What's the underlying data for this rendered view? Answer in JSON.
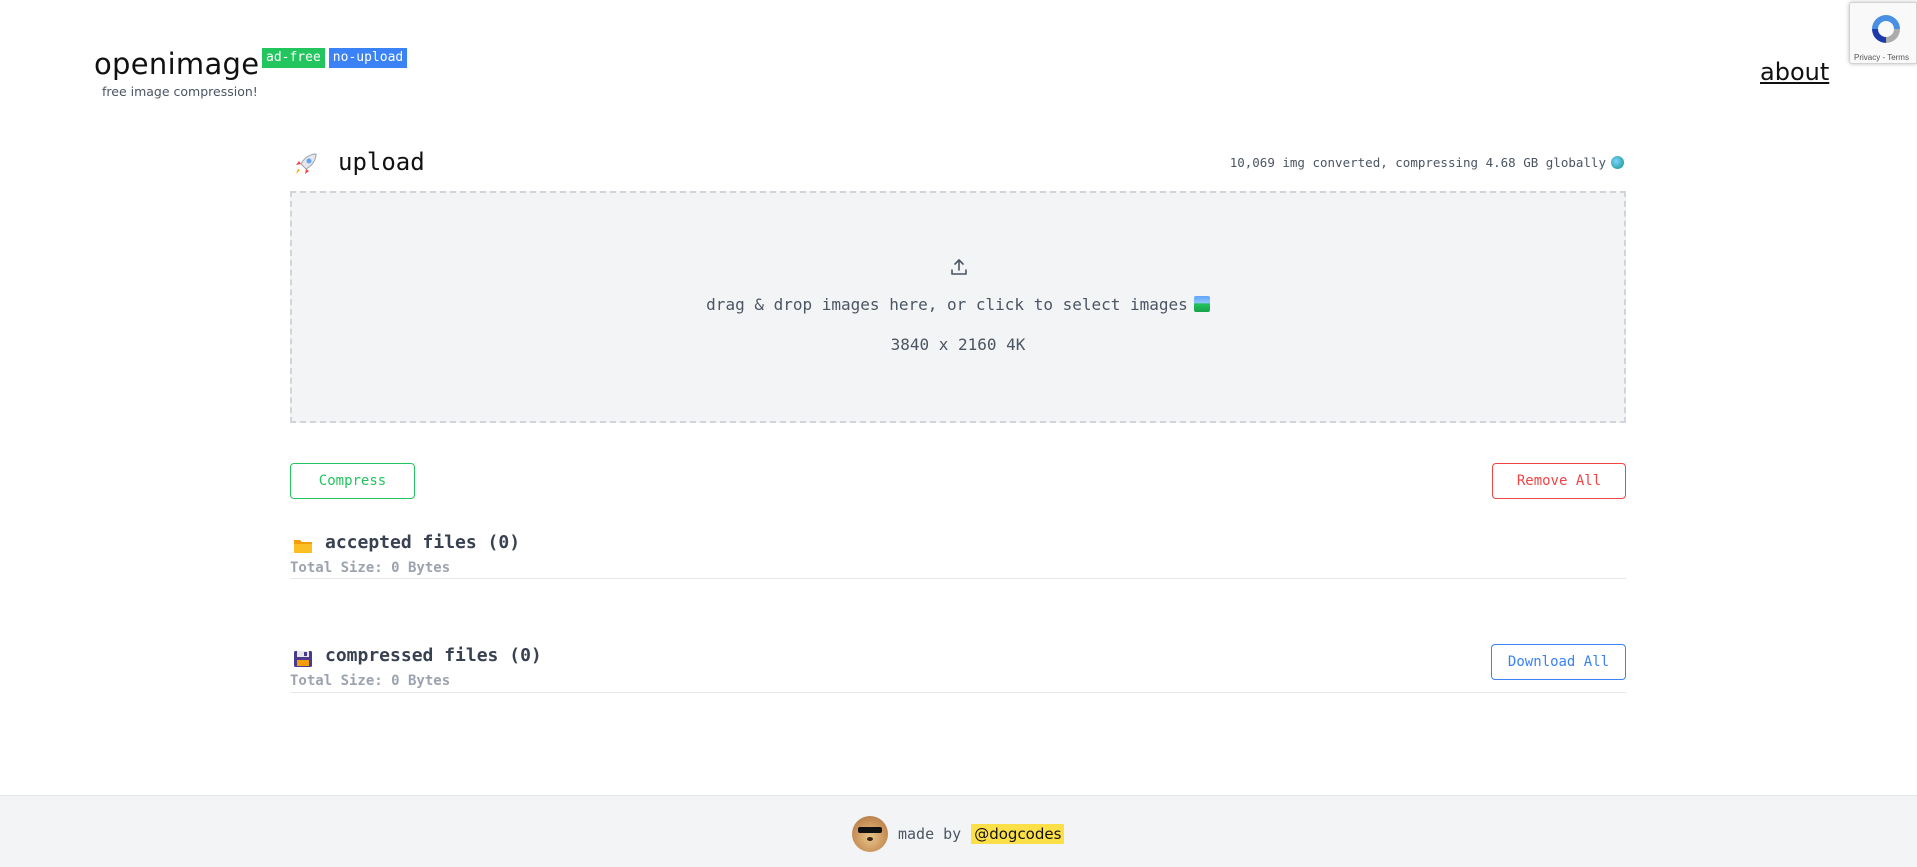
{
  "header": {
    "brand": "openimage",
    "badges": [
      "ad-free",
      "no-upload"
    ],
    "tagline": "free image compression!",
    "about_link": "about"
  },
  "recaptcha": {
    "footer_text": "Privacy - Terms"
  },
  "upload": {
    "title": "upload",
    "title_icon": "rocket-icon",
    "stats": "10,069 img converted, compressing 4.68 GB globally",
    "stats_icon": "globe-icon",
    "dropzone_icon": "upload-icon",
    "dropzone_text": "drag & drop images here, or click to select images",
    "dropzone_text_icon": "picture-icon",
    "resolution": "3840 x 2160 4K"
  },
  "actions": {
    "compress_label": "Compress",
    "remove_all_label": "Remove All",
    "download_all_label": "Download All"
  },
  "accepted": {
    "icon": "folder-icon",
    "title": "accepted files (0)",
    "total_size": "Total Size: 0 Bytes"
  },
  "compressed": {
    "icon": "floppy-disk-icon",
    "title": "compressed files (0)",
    "total_size": "Total Size: 0 Bytes"
  },
  "footer": {
    "avatar_icon": "dog-avatar",
    "made_by": "made by",
    "handle": "@dogcodes"
  },
  "colors": {
    "green": "#22c55e",
    "blue": "#3b82f6",
    "red": "#ef4444",
    "handle_highlight": "#fde047",
    "dropzone_bg": "#f3f4f6"
  }
}
